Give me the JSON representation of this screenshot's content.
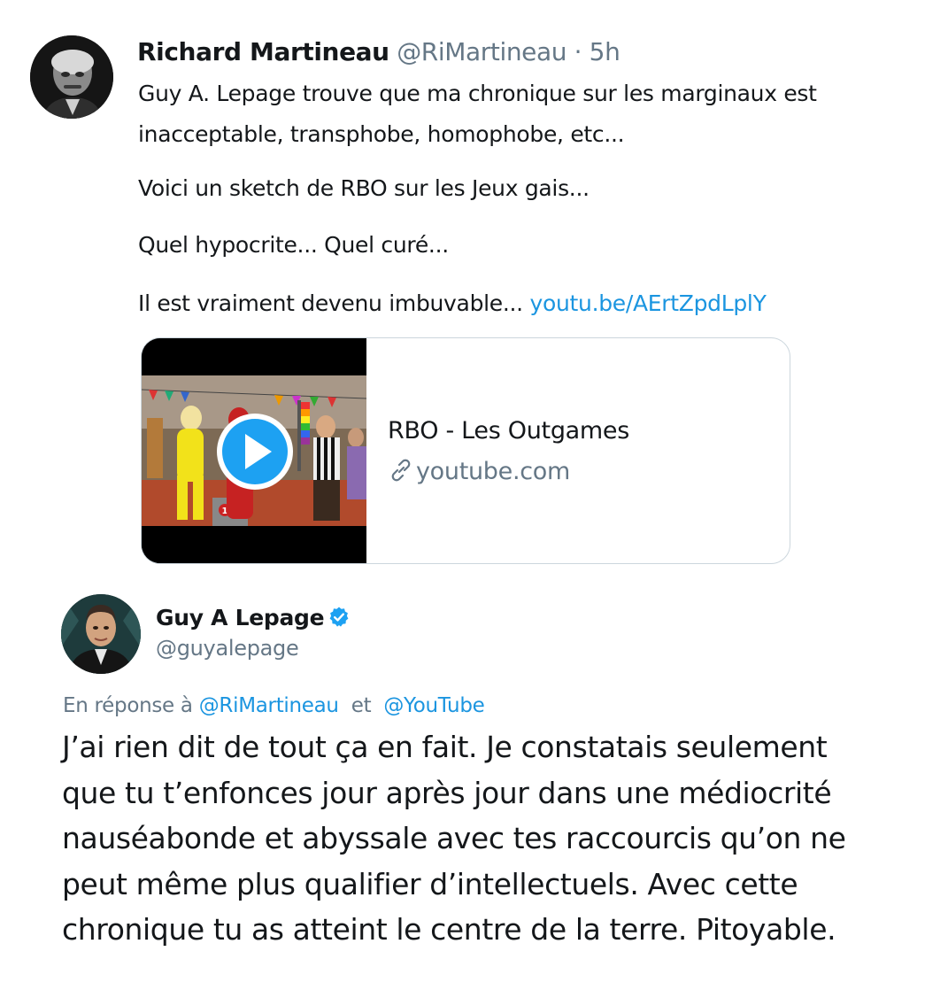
{
  "tweet1": {
    "author_name": "Richard Martineau",
    "author_handle": "@RiMartineau",
    "separator": "·",
    "time": "5h",
    "lines": [
      "Guy A. Lepage trouve que ma chronique sur les marginaux est",
      "inacceptable, transphobe, homophobe, etc...",
      "Voici un sketch de RBO sur les Jeux gais...",
      "Quel hypocrite... Quel curé...",
      "Il est vraiment devenu imbuvable..."
    ],
    "link": "youtu.be/AErtZpdLplY",
    "card": {
      "title": "RBO - Les Outgames",
      "domain": "youtube.com",
      "podium_number": "1"
    }
  },
  "tweet2": {
    "author_name": "Guy A Lepage",
    "author_handle": "@guyalepage",
    "reply_prefix": "En réponse à",
    "reply_mention_1": "@RiMartineau",
    "reply_joiner": "et",
    "reply_mention_2": "@YouTube",
    "body_lines": [
      "J’ai rien dit de tout ça en fait. Je constatais seulement",
      "que tu t’enfonces jour après jour dans une médiocrité",
      "nauséabonde et abyssale avec tes raccourcis qu’on ne",
      "peut même plus qualifier d’intellectuels. Avec cette",
      "chronique tu as atteint le centre de la terre. Pitoyable."
    ]
  },
  "icons": {
    "link_icon": "link-icon",
    "verified_icon": "verified-badge-icon",
    "play_icon": "play-icon"
  },
  "colors": {
    "link_blue": "#1b95e0",
    "muted_gray": "#657786",
    "text_dark": "#14171a",
    "verified_blue": "#1da1f2",
    "card_border": "#ccd6dd"
  }
}
